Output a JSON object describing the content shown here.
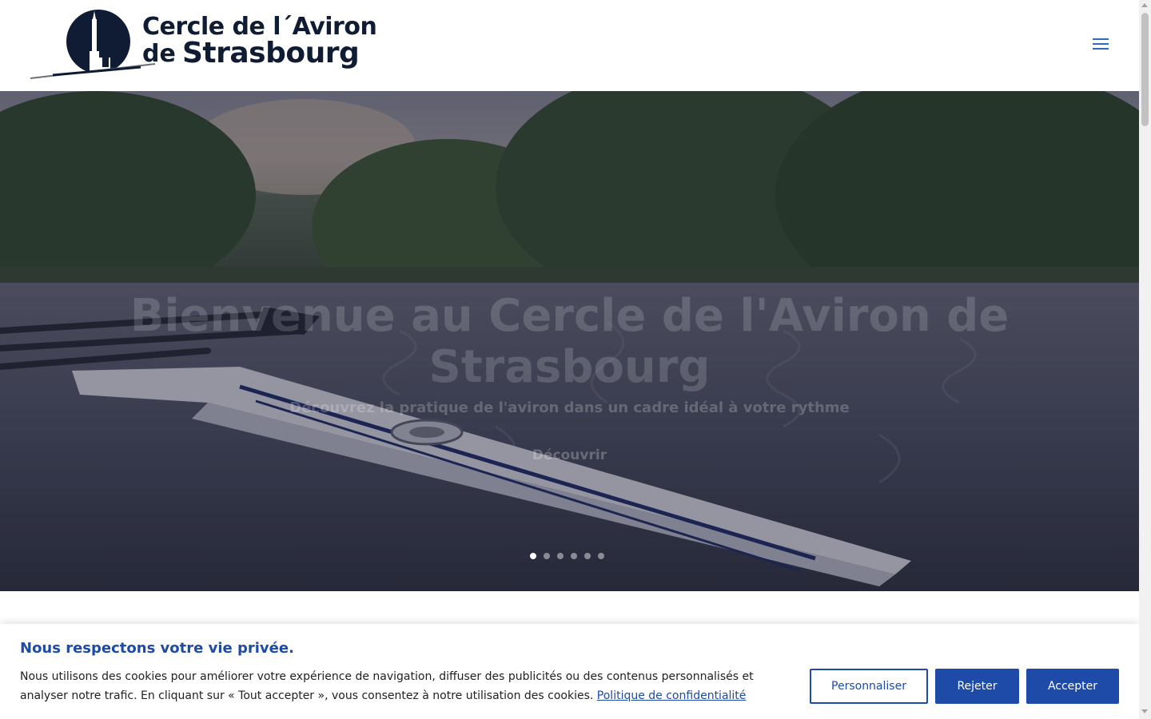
{
  "header": {
    "logo": {
      "line1": "Cercle de l´Aviron",
      "line2_small": "de",
      "line2_large": "Strasbourg"
    }
  },
  "hero": {
    "title": "Bienvenue au Cercle de l'Aviron de Strasbourg",
    "subtitle": "Découvrez la pratique de l'aviron dans un cadre idéal à votre rythme",
    "cta_label": "Découvrir",
    "slide_count": 6,
    "active_slide": 1
  },
  "cookie_banner": {
    "title": "Nous respectons votre vie privée.",
    "text": "Nous utilisons des cookies pour améliorer votre expérience de navigation, diffuser des publicités ou des contenus personnalisés et analyser notre trafic. En cliquant sur « Tout accepter », vous consentez à notre utilisation des cookies.",
    "link_label": "Politique de confidentialité",
    "buttons": {
      "customize": "Personnaliser",
      "reject": "Rejeter",
      "accept": "Accepter"
    }
  },
  "colors": {
    "brand_navy": "#0f1c34",
    "accent_blue": "#1e4aa8",
    "menu_icon": "#2e6cb6"
  },
  "icons": [
    "hamburger-menu-icon",
    "slider-dot-icon"
  ]
}
